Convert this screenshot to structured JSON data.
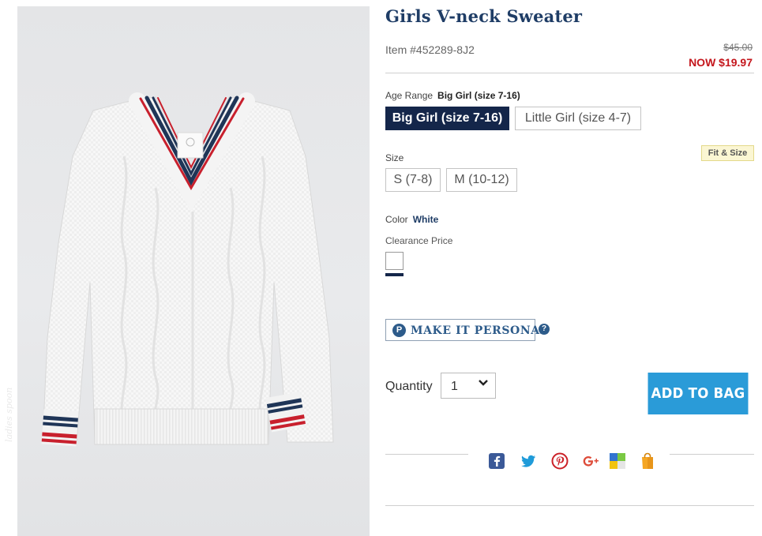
{
  "product": {
    "title": "Girls V-neck Sweater",
    "item_number": "Item #452289-8J2",
    "price_was": "$45.00",
    "price_now": "NOW $19.97"
  },
  "age_range": {
    "label": "Age Range",
    "selected": "Big Girl (size 7-16)",
    "options": [
      "Big Girl (size 7-16)",
      "Little Girl (size 4-7)"
    ]
  },
  "size": {
    "label": "Size",
    "fit_link": "Fit & Size",
    "options": [
      "S (7-8)",
      "M (10-12)"
    ]
  },
  "color": {
    "label": "Color",
    "selected": "White",
    "clearance_label": "Clearance Price",
    "swatch_color": "#ffffff"
  },
  "personalize": {
    "icon_letter": "P",
    "label": "MAKE IT PERSONAL",
    "help_icon": "?"
  },
  "quantity": {
    "label": "Quantity",
    "value": "1"
  },
  "cart": {
    "add_label": "ADD TO BAG"
  },
  "share": {
    "icons": [
      "facebook-icon",
      "twitter-icon",
      "pinterest-icon",
      "google-plus-icon",
      "delicious-icon",
      "shopping-bag-icon"
    ]
  },
  "image": {
    "watermark": "ladies spoon"
  },
  "colors": {
    "title": "#1f3d66",
    "sale": "#c4161c",
    "selected_button": "#14264a",
    "add_to_bag": "#2a9bd8",
    "personal": "#2d5b8a"
  }
}
